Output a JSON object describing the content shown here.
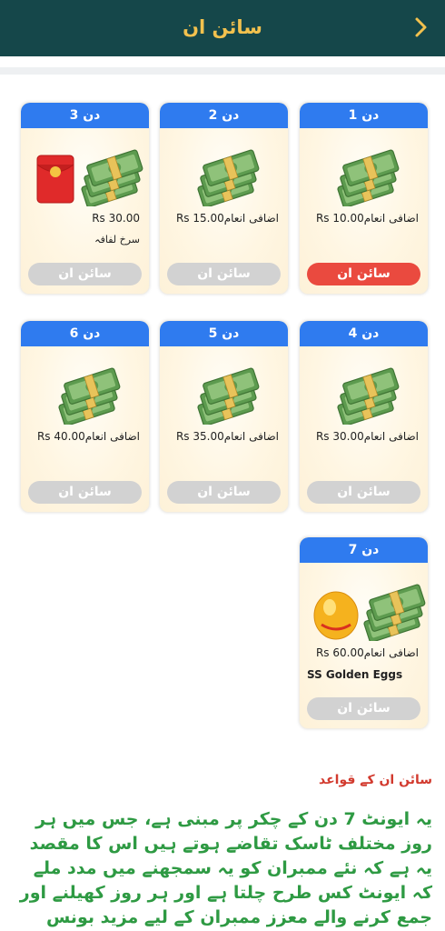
{
  "header": {
    "title": "سائن ان"
  },
  "days": [
    {
      "day": "دن 1",
      "reward": "اضافی انعامRs 10.00",
      "extra": "",
      "button": "سائن ان",
      "active": true,
      "art": "cash"
    },
    {
      "day": "دن 2",
      "reward": "اضافی انعامRs 15.00",
      "extra": "",
      "button": "سائن ان",
      "active": false,
      "art": "cash"
    },
    {
      "day": "دن 3",
      "reward": "30.00 Rs",
      "extra": "سرخ لفافہ",
      "button": "سائن ان",
      "active": false,
      "art": "envelope-cash"
    },
    {
      "day": "دن 4",
      "reward": "اضافی انعامRs 30.00",
      "extra": "",
      "button": "سائن ان",
      "active": false,
      "art": "cash"
    },
    {
      "day": "دن 5",
      "reward": "اضافی انعامRs 35.00",
      "extra": "",
      "button": "سائن ان",
      "active": false,
      "art": "cash"
    },
    {
      "day": "دن 6",
      "reward": "اضافی انعامRs 40.00",
      "extra": "",
      "button": "سائن ان",
      "active": false,
      "art": "cash"
    },
    {
      "day": "دن 7",
      "reward": "اضافی انعامRs 60.00",
      "extra": "SS Golden Eggs",
      "button": "سائن ان",
      "active": false,
      "art": "egg-cash"
    }
  ],
  "rules": {
    "title": "سائن ان کے قواعد",
    "text": "یہ ایونٹ 7 دن کے چکر پر مبنی ہے، جس میں ہر روز مختلف ٹاسک تقاضے ہوتے ہیں اس کا مقصد یہ ہے کہ نئے ممبران کو یہ سمجھنے میں مدد ملے کہ ایونٹ کس طرح چلتا ہے اور ہر روز کھیلنے اور جمع کرنے والے معزز ممبران کے لیے مزید بونس فوائد حاصل کرنے کی"
  },
  "colors": {
    "header_bg": "#15474a",
    "header_text": "#f2c14e",
    "day_badge": "#2f7bef",
    "active_button": "#ea4a3f",
    "inactive_button": "#d2d2d2",
    "rules_title": "#d23a2e",
    "rules_text": "#2e9a43"
  },
  "icons": {
    "back": "chevron-right-icon",
    "cash": "cash-stack-icon",
    "envelope": "red-envelope-icon",
    "egg": "golden-egg-icon"
  }
}
